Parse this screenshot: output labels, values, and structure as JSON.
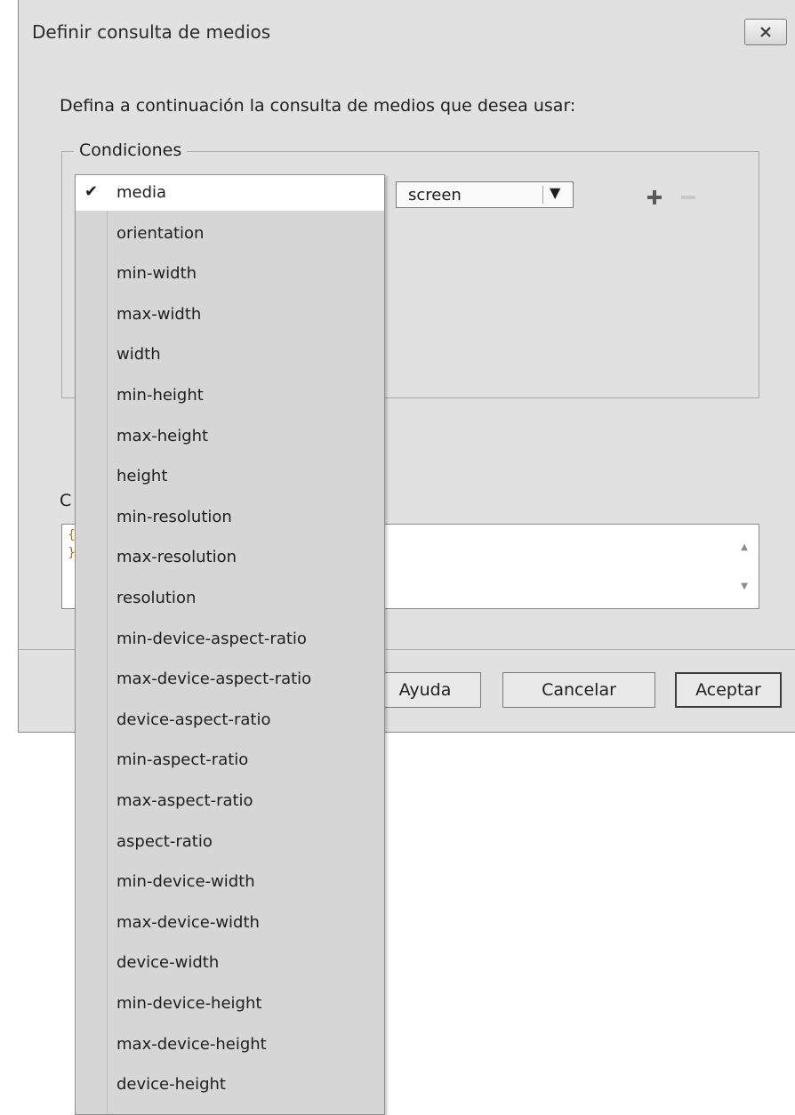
{
  "dialog": {
    "title": "Definir consulta de medios",
    "prompt": "Defina a continuación la consulta de medios que desea usar:",
    "conditions_label": "Condiciones",
    "condition_value": "screen",
    "code_label": "C",
    "code_lines": [
      "{",
      "}"
    ],
    "buttons": {
      "help": "Ayuda",
      "cancel": "Cancelar",
      "ok": "Aceptar"
    }
  },
  "dropdown": {
    "selected": "media",
    "items": [
      "media",
      "orientation",
      "min-width",
      "max-width",
      "width",
      "min-height",
      "max-height",
      "height",
      "min-resolution",
      "max-resolution",
      "resolution",
      "min-device-aspect-ratio",
      "max-device-aspect-ratio",
      "device-aspect-ratio",
      "min-aspect-ratio",
      "max-aspect-ratio",
      "aspect-ratio",
      "min-device-width",
      "max-device-width",
      "device-width",
      "min-device-height",
      "max-device-height",
      "device-height"
    ]
  }
}
